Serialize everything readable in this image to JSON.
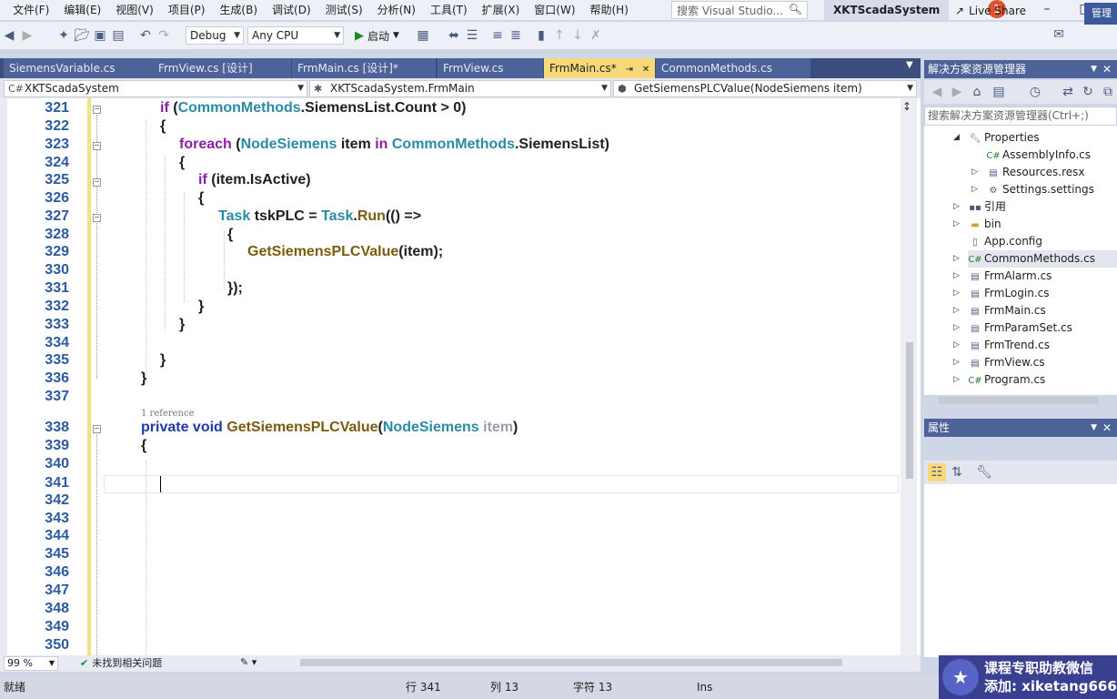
{
  "menu": [
    "文件(F)",
    "编辑(E)",
    "视图(V)",
    "项目(P)",
    "生成(B)",
    "调试(D)",
    "测试(S)",
    "分析(N)",
    "工具(T)",
    "扩展(X)",
    "窗口(W)",
    "帮助(H)"
  ],
  "search_placeholder": "搜索 Visual Studio...",
  "app_title": "XKTScadaSystem",
  "notification_count": "1",
  "toolbar": {
    "config": "Debug",
    "platform": "Any CPU",
    "start_label": "启动",
    "live_share": "Live Share",
    "manage": "管理"
  },
  "tabs": [
    {
      "label": "SiemensVariable.cs",
      "active": false
    },
    {
      "label": "FrmView.cs [设计]",
      "active": false
    },
    {
      "label": "FrmMain.cs [设计]*",
      "active": false
    },
    {
      "label": "FrmView.cs",
      "active": false
    },
    {
      "label": "FrmMain.cs*",
      "active": true
    },
    {
      "label": "CommonMethods.cs",
      "active": false
    }
  ],
  "nav": {
    "project": "XKTScadaSystem",
    "class": "XKTScadaSystem.FrmMain",
    "member": "GetSiemensPLCValue(NodeSiemens item)"
  },
  "code": {
    "line_numbers": [
      "321",
      "322",
      "323",
      "324",
      "325",
      "326",
      "327",
      "328",
      "329",
      "330",
      "331",
      "332",
      "333",
      "334",
      "335",
      "336",
      "337",
      "338",
      "339",
      "340",
      "341",
      "342",
      "343",
      "344",
      "345",
      "346",
      "347",
      "348",
      "349",
      "350"
    ],
    "reference_hint": "1 reference",
    "tokens": {
      "if": "if",
      "common_methods": "CommonMethods",
      "siemens_list_count": ".SiemensList.Count > 0)",
      "foreach": "foreach",
      "node_siemens": "NodeSiemens",
      "item_in": " item ",
      "in": "in",
      "siemens_list": ".SiemensList)",
      "item_isactive": "(item.IsActive)",
      "task": "Task",
      "tsk_plc": " tskPLC = ",
      "run": "Run",
      "lambda": "(() =>",
      "get_siemens": "GetSiemensPLCValue",
      "item_call": "(item);",
      "close_lambda": "});",
      "private_void": "private void ",
      "param_item": "item",
      "open_paren": "(",
      "close_paren": ")",
      "dot": ".",
      "space": " ",
      "brace_open": "{",
      "brace_close": "}"
    }
  },
  "editor_status": {
    "zoom": "99 %",
    "issues": "未找到相关问题"
  },
  "statusbar": {
    "ready": "就绪",
    "line": "行 341",
    "col": "列 13",
    "char": "字符 13",
    "ins": "Ins"
  },
  "solution_explorer": {
    "title": "解决方案资源管理器",
    "search_placeholder": "搜索解决方案资源管理器(Ctrl+;)",
    "items": [
      {
        "label": "Properties",
        "icon": "wrench-icon"
      },
      {
        "label": "AssemblyInfo.cs",
        "icon": "csharp-file-icon"
      },
      {
        "label": "Resources.resx",
        "icon": "resource-file-icon"
      },
      {
        "label": "Settings.settings",
        "icon": "settings-icon"
      },
      {
        "label": "引用",
        "icon": "references-icon"
      },
      {
        "label": "bin",
        "icon": "folder-icon"
      },
      {
        "label": "App.config",
        "icon": "config-file-icon"
      },
      {
        "label": "CommonMethods.cs",
        "icon": "csharp-file-icon"
      },
      {
        "label": "FrmAlarm.cs",
        "icon": "form-icon"
      },
      {
        "label": "FrmLogin.cs",
        "icon": "form-icon"
      },
      {
        "label": "FrmMain.cs",
        "icon": "form-icon"
      },
      {
        "label": "FrmParamSet.cs",
        "icon": "form-icon"
      },
      {
        "label": "FrmTrend.cs",
        "icon": "form-icon"
      },
      {
        "label": "FrmView.cs",
        "icon": "form-icon"
      },
      {
        "label": "Program.cs",
        "icon": "csharp-file-icon"
      }
    ]
  },
  "properties": {
    "title": "属性"
  },
  "watermark": {
    "line1": "课程专职助教微信",
    "line2": "添加: xiketang666"
  }
}
